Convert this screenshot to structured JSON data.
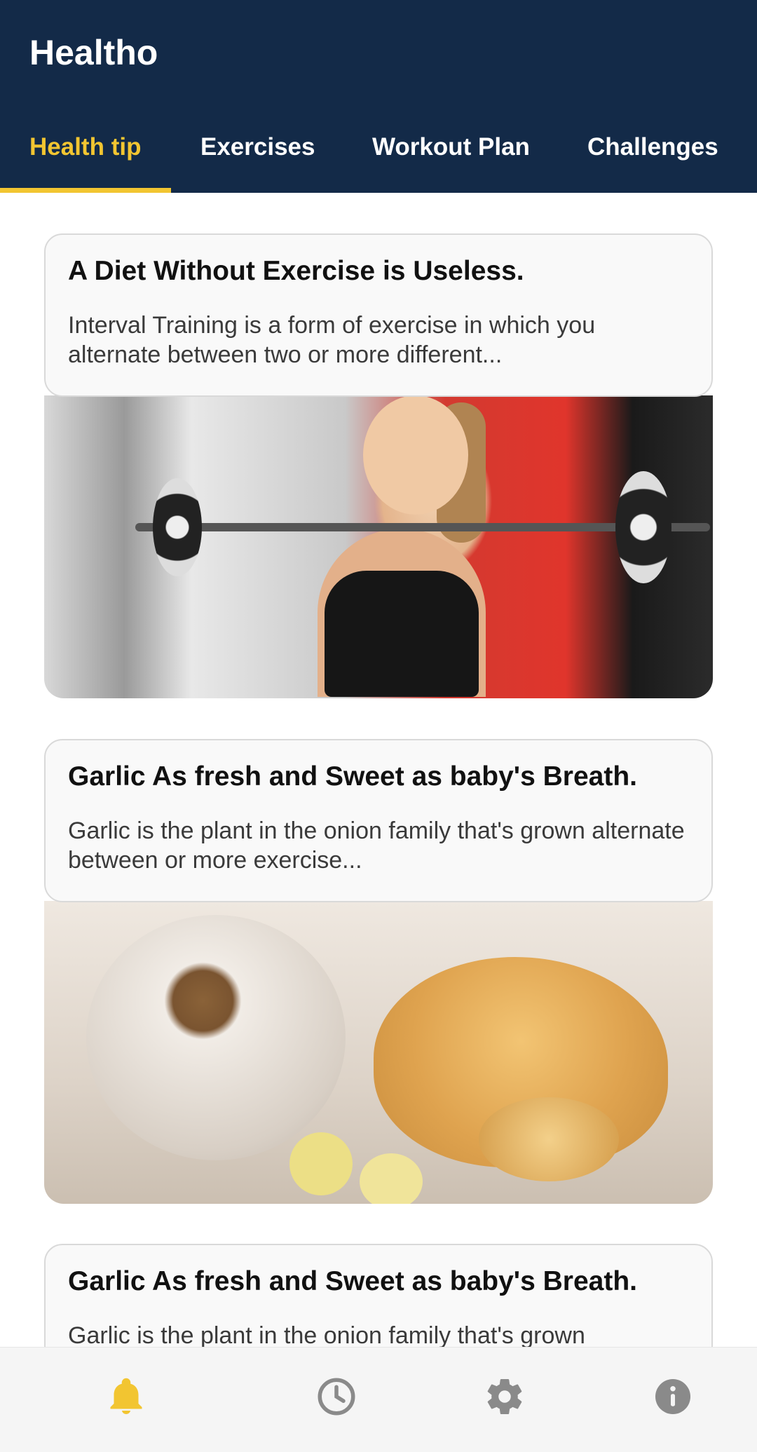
{
  "app": {
    "title": "Healtho"
  },
  "tabs": [
    {
      "label": "Health tip",
      "active": true
    },
    {
      "label": "Exercises",
      "active": false
    },
    {
      "label": "Workout Plan",
      "active": false
    },
    {
      "label": "Challenges",
      "active": false
    }
  ],
  "colors": {
    "appbar": "#132a48",
    "accent": "#f2c531",
    "icon_inactive": "#8a8a8a"
  },
  "cards": [
    {
      "title": "A Diet Without Exercise is Useless.",
      "body": "Interval Training is a form of exercise in which you alternate between two or more different...",
      "image": "woman-lifting-barbell-photo"
    },
    {
      "title": "Garlic As fresh and Sweet as baby's Breath.",
      "body": "Garlic is the plant in the onion family that's grown alternate between  or more exercise...",
      "image": "garlic-bulbs-photo"
    },
    {
      "title": "Garlic As fresh and Sweet as baby's Breath.",
      "body": "Garlic is the plant in the onion family that's grown"
    }
  ],
  "bottom_nav": [
    {
      "icon": "bell-icon",
      "active": true
    },
    {
      "icon": "clock-icon",
      "active": false
    },
    {
      "icon": "gear-icon",
      "active": false
    },
    {
      "icon": "info-icon",
      "active": false
    }
  ]
}
